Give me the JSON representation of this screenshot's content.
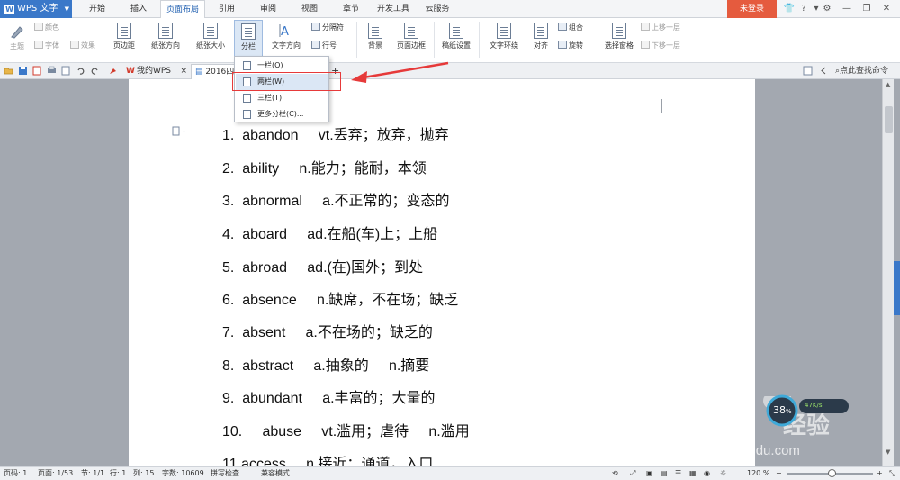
{
  "title_bar": {
    "app_name": "WPS 文字",
    "tabs": [
      "开始",
      "插入",
      "页面布局",
      "引用",
      "审阅",
      "视图",
      "章节",
      "开发工具",
      "云服务"
    ],
    "active_tab": "页面布局",
    "login_label": "未登录",
    "help_label": "?"
  },
  "ribbon": {
    "theme": "主题",
    "color": "颜色",
    "font": "字体",
    "effect": "效果",
    "margins": "页边距",
    "orientation": "纸张方向",
    "size": "纸张大小",
    "columns": "分栏",
    "text_direction": "文字方向",
    "breaks": "分隔符",
    "line_numbers": "行号",
    "background": "背景",
    "page_border": "页面边框",
    "manuscript": "稿纸设置",
    "text_wrap": "文字环绕",
    "align": "对齐",
    "group": "组合",
    "rotate": "旋转",
    "selection_pane": "选择窗格",
    "bring_forward": "上移一层",
    "send_backward": "下移一层"
  },
  "tabs_bar": {
    "my_wps": "我的WPS",
    "doc_tab": "2016四",
    "search_label": "点此查找命令"
  },
  "columns_menu": {
    "items": [
      "一栏(O)",
      "两栏(W)",
      "三栏(T)",
      "更多分栏(C)..."
    ],
    "highlighted": "两栏(W)"
  },
  "document": {
    "lines": [
      "1.  abandon     vt.丢弃；放弃，抛弃",
      "2.  ability     n.能力；能耐，本领",
      "3.  abnormal     a.不正常的；变态的",
      "4.  aboard     ad.在船(车)上；上船",
      "5.  abroad     ad.(在)国外；到处",
      "6.  absence     n.缺席，不在场；缺乏",
      "7.  absent     a.不在场的；缺乏的",
      "8.  abstract     a.抽象的     n.摘要",
      "9.  abundant     a.丰富的；大量的",
      "10.     abuse     vt.滥用；虐待     n.滥用",
      "11.access     n.接近；通道，入口"
    ]
  },
  "status_bar": {
    "page_code": "页码: 1",
    "page": "页面: 1/53",
    "section": "节: 1/1",
    "row": "行: 1",
    "col": "列: 15",
    "word_count": "字数: 10609",
    "spell_check": "拼写检查",
    "compat_mode": "兼容模式",
    "zoom": "120 %"
  },
  "watermark": {
    "brand": "Bai",
    "brand_tail": "经验",
    "url": "jingyan.baidu.com"
  },
  "floating_widget": {
    "value": "38",
    "unit": "%",
    "speed": "47K/s"
  },
  "colors": {
    "accent": "#3a78c9",
    "login": "#e55b3e",
    "highlight_box": "#e63a3a"
  }
}
